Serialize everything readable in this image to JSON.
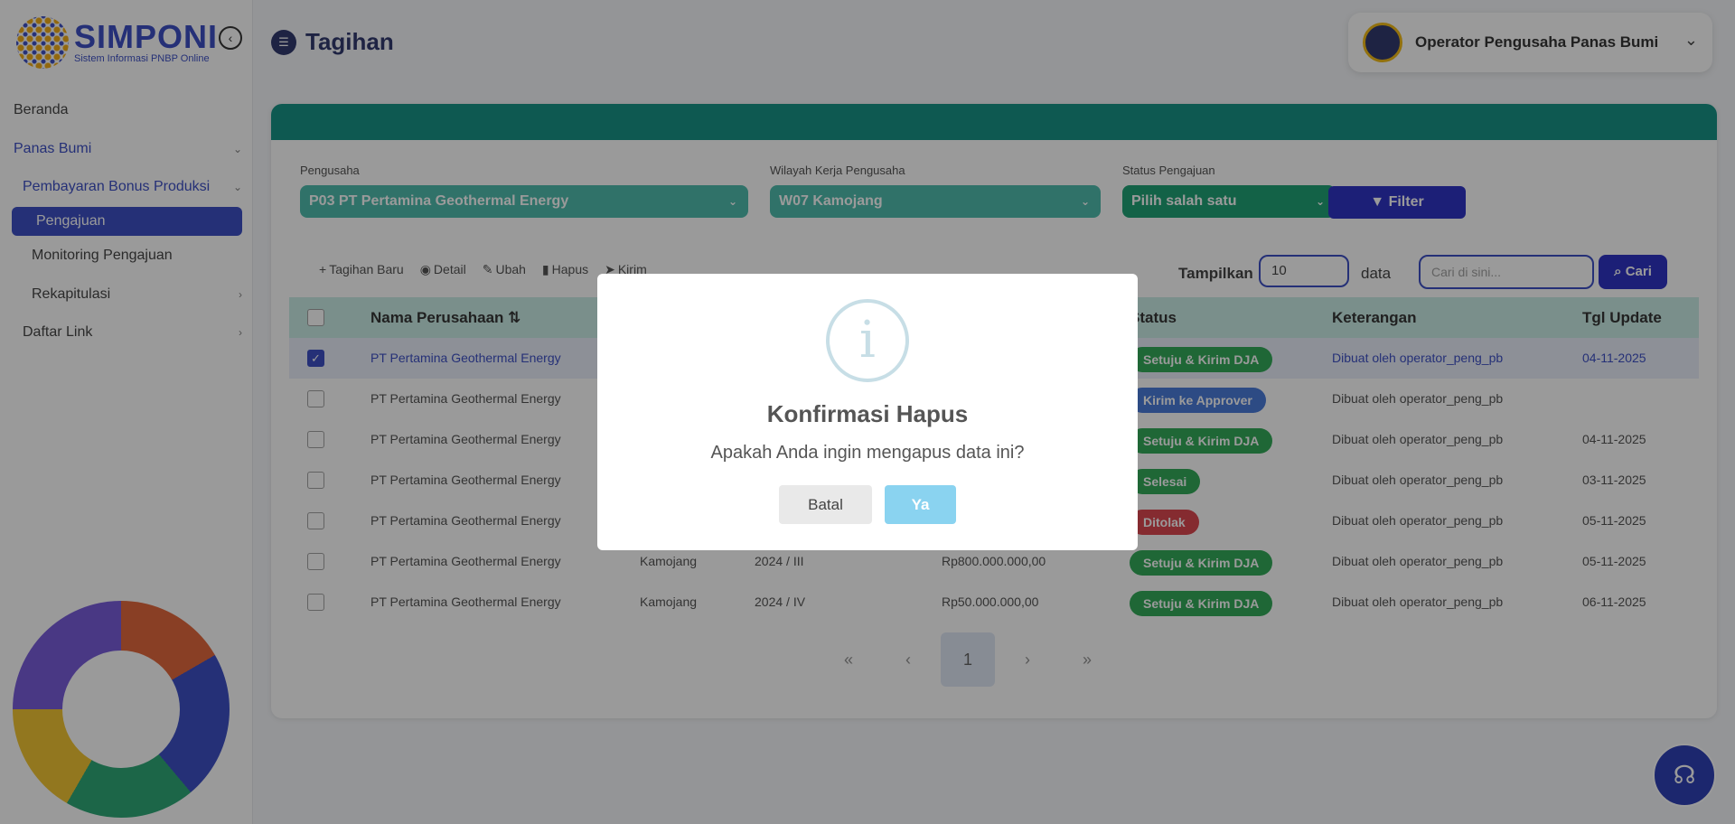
{
  "brand": {
    "title": "SIMPONI",
    "subtitle": "Sistem Informasi PNBP Online"
  },
  "sidebar": {
    "items": [
      {
        "label": "Beranda"
      },
      {
        "label": "Panas Bumi"
      },
      {
        "label": "Pembayaran Bonus Produksi"
      },
      {
        "label": "Pengajuan"
      },
      {
        "label": "Monitoring Pengajuan"
      },
      {
        "label": "Rekapitulasi"
      },
      {
        "label": "Daftar Link"
      }
    ]
  },
  "header": {
    "title": "Tagihan",
    "user": "Operator Pengusaha Panas Bumi"
  },
  "filters": {
    "pengusaha_label": "Pengusaha",
    "pengusaha_value": "P03 PT Pertamina Geothermal Energy",
    "wilayah_label": "Wilayah Kerja Pengusaha",
    "wilayah_value": "W07 Kamojang",
    "status_label": "Status Pengajuan",
    "status_value": "Pilih salah satu",
    "filter_button": "Filter"
  },
  "toolbar": {
    "new": "Tagihan Baru",
    "detail": "Detail",
    "edit": "Ubah",
    "delete": "Hapus",
    "send": "Kirim"
  },
  "display": {
    "show_label": "Tampilkan",
    "page_size": "10",
    "data_label": "data",
    "search_placeholder": "Cari di sini...",
    "search_button": "Cari"
  },
  "table": {
    "columns": [
      "Nama Perusahaan",
      "Status",
      "Keterangan",
      "Tgl Update"
    ],
    "rows": [
      {
        "company": "PT Pertamina Geothermal Energy",
        "wk": "",
        "period": "",
        "amount": "",
        "status": "Setuju & Kirim DJA",
        "status_color": "#1fa34a",
        "note": "Dibuat oleh operator_peng_pb",
        "date": "04-11-2025",
        "checked": true
      },
      {
        "company": "PT Pertamina Geothermal Energy",
        "wk": "",
        "period": "",
        "amount": "",
        "status": "Kirim ke Approver",
        "status_color": "#3a6fd8",
        "note": "Dibuat oleh operator_peng_pb",
        "date": "",
        "checked": false
      },
      {
        "company": "PT Pertamina Geothermal Energy",
        "wk": "",
        "period": "",
        "amount": "",
        "status": "Setuju & Kirim DJA",
        "status_color": "#1fa34a",
        "note": "Dibuat oleh operator_peng_pb",
        "date": "04-11-2025",
        "checked": false
      },
      {
        "company": "PT Pertamina Geothermal Energy",
        "wk": "",
        "period": "",
        "amount": "",
        "status": "Selesai",
        "status_color": "#1fa34a",
        "note": "Dibuat oleh operator_peng_pb",
        "date": "03-11-2025",
        "checked": false
      },
      {
        "company": "PT Pertamina Geothermal Energy",
        "wk": "",
        "period": "",
        "amount": "",
        "status": "Ditolak",
        "status_color": "#d9363e",
        "note": "Dibuat oleh operator_peng_pb",
        "date": "05-11-2025",
        "checked": false
      },
      {
        "company": "PT Pertamina Geothermal Energy",
        "wk": "Kamojang",
        "period": "2024 / III",
        "amount": "Rp800.000.000,00",
        "status": "Setuju & Kirim DJA",
        "status_color": "#1fa34a",
        "note": "Dibuat oleh operator_peng_pb",
        "date": "05-11-2025",
        "checked": false
      },
      {
        "company": "PT Pertamina Geothermal Energy",
        "wk": "Kamojang",
        "period": "2024 / IV",
        "amount": "Rp50.000.000,00",
        "status": "Setuju & Kirim DJA",
        "status_color": "#1fa34a",
        "note": "Dibuat oleh operator_peng_pb",
        "date": "06-11-2025",
        "checked": false
      }
    ]
  },
  "pager": {
    "first": "«",
    "prev": "‹",
    "current": "1",
    "next": "›",
    "last": "»"
  },
  "modal": {
    "icon": "i",
    "title": "Konfirmasi Hapus",
    "text": "Apakah Anda ingin mengapus data ini?",
    "cancel": "Batal",
    "confirm": "Ya"
  }
}
